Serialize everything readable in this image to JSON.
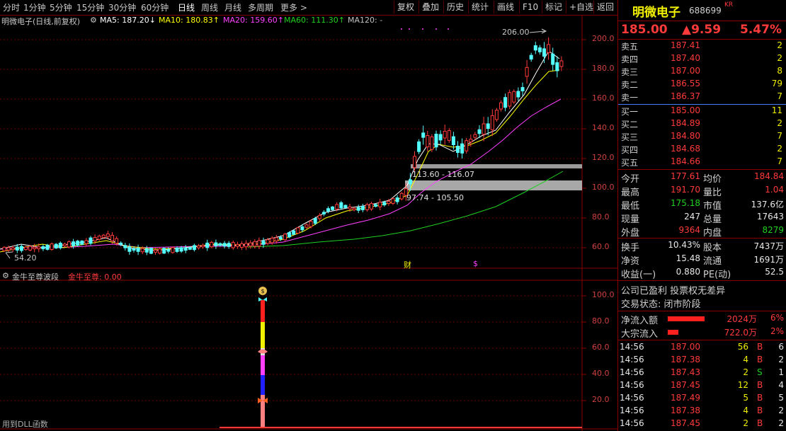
{
  "toolbar": {
    "periods": [
      "分时",
      "1分钟",
      "5分钟",
      "15分钟",
      "30分钟",
      "60分钟",
      "日线",
      "周线",
      "月线",
      "多周期",
      "更多 >"
    ],
    "active_period": "日线",
    "right_buttons": [
      "复权",
      "叠加",
      "历史",
      "统计",
      "画线",
      "F10",
      "标记",
      "+自选",
      "返回"
    ]
  },
  "legend": {
    "title": "明微电子(日线,前复权)",
    "ma5": "MA5: 187.20↓",
    "ma10": "MA10: 180.83↑",
    "ma20": "MA20: 159.60↑",
    "ma60": "MA60: 111.30↑",
    "ma120": "MA120: -"
  },
  "annotations": {
    "high": "206.00",
    "low": "54.20",
    "zone1": "113.60 - 116.07",
    "zone2": "97.74 - 105.50",
    "finance_marker": "财",
    "dollar_marker": "$"
  },
  "price_axis": [
    "200.0",
    "180.0",
    "160.0",
    "140.0",
    "120.0",
    "100.0",
    "80.0",
    "60.0"
  ],
  "indicator": {
    "name": "金牛至尊波段",
    "value_label": "金牛至尊: 0.00",
    "axis": [
      "100.0",
      "80.0",
      "60.0",
      "40.0",
      "20.0"
    ],
    "footer": "用到DLL函数"
  },
  "colors": {
    "up": "#ff3a3a",
    "down": "#54ffff",
    "ma5": "#ffffff",
    "ma10": "#ffff00",
    "ma20": "#ff40ff",
    "ma60": "#20d020",
    "ma120": "#c0c0c0"
  },
  "quote": {
    "name": "明微电子",
    "code": "688699",
    "tag": "KR",
    "price": "185.00",
    "change": "▲9.59",
    "pct": "5.47%"
  },
  "asks": [
    {
      "label": "卖五",
      "price": "187.41",
      "vol": "2"
    },
    {
      "label": "卖四",
      "price": "187.40",
      "vol": "2"
    },
    {
      "label": "卖三",
      "price": "187.00",
      "vol": "8"
    },
    {
      "label": "卖二",
      "price": "186.55",
      "vol": "79"
    },
    {
      "label": "卖一",
      "price": "186.37",
      "vol": "7"
    }
  ],
  "bids": [
    {
      "label": "买一",
      "price": "185.00",
      "vol": "11"
    },
    {
      "label": "买二",
      "price": "184.89",
      "vol": "2"
    },
    {
      "label": "买三",
      "price": "184.80",
      "vol": "7"
    },
    {
      "label": "买四",
      "price": "184.68",
      "vol": "2"
    },
    {
      "label": "买五",
      "price": "184.66",
      "vol": "7"
    }
  ],
  "stats": [
    {
      "l1": "今开",
      "v1": "177.61",
      "c1": "red",
      "l2": "均价",
      "v2": "184.84",
      "c2": "red"
    },
    {
      "l1": "最高",
      "v1": "191.70",
      "c1": "red",
      "l2": "量比",
      "v2": "1.04",
      "c2": "red"
    },
    {
      "l1": "最低",
      "v1": "175.18",
      "c1": "green",
      "l2": "市值",
      "v2": "137.6亿",
      "c2": "white"
    },
    {
      "l1": "现量",
      "v1": "247",
      "c1": "white",
      "l2": "总量",
      "v2": "17643",
      "c2": "white"
    },
    {
      "l1": "外盘",
      "v1": "9364",
      "c1": "red",
      "l2": "内盘",
      "v2": "8279",
      "c2": "green"
    }
  ],
  "stats2": [
    {
      "l1": "换手",
      "v1": "10.43%",
      "l2": "股本",
      "v2": "7437万"
    },
    {
      "l1": "净资",
      "v1": "15.48",
      "l2": "流通",
      "v2": "1691万"
    },
    {
      "l1": "收益(一)",
      "v1": "0.880",
      "l2": "PE(动)",
      "v2": "52.5"
    }
  ],
  "notes": [
    "公司已盈利 投票权无差异",
    "交易状态: 闭市阶段"
  ],
  "flows": [
    {
      "label": "净流入额",
      "value": "2024万",
      "pct": "6%",
      "bar": 0.94
    },
    {
      "label": "大宗流入",
      "value": "722.0万",
      "pct": "2%",
      "bar": 0.28
    }
  ],
  "trades": [
    {
      "time": "14:56",
      "price": "187.00",
      "vol": "56",
      "side": "B",
      "n": "6"
    },
    {
      "time": "14:56",
      "price": "187.38",
      "vol": "4",
      "side": "B",
      "n": "2"
    },
    {
      "time": "14:56",
      "price": "187.43",
      "vol": "2",
      "side": "S",
      "n": "1"
    },
    {
      "time": "14:56",
      "price": "187.45",
      "vol": "12",
      "side": "B",
      "n": "4"
    },
    {
      "time": "14:56",
      "price": "187.49",
      "vol": "5",
      "side": "B",
      "n": "5"
    },
    {
      "time": "14:56",
      "price": "187.38",
      "vol": "4",
      "side": "B",
      "n": "2"
    },
    {
      "time": "14:56",
      "price": "187.45",
      "vol": "2",
      "side": "B",
      "n": "2"
    }
  ]
}
